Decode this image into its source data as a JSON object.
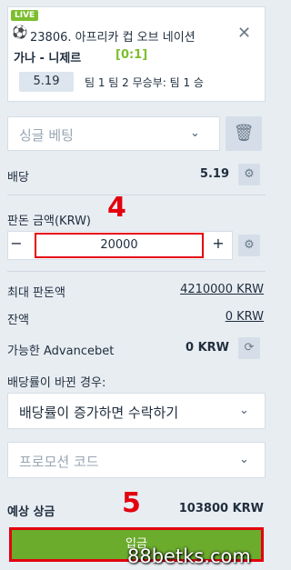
{
  "bet": {
    "live_badge": "LIVE",
    "match_id": "23806. 아프리카 컵 오브 네이션",
    "teams": "가나 - 니제르",
    "score": "[0:1]",
    "odds": "5.19",
    "market": "팀 1 팀 2 무승부: 팀 1 승"
  },
  "bet_type": {
    "selected": "싱글 베팅"
  },
  "odds_row": {
    "label": "배당",
    "value": "5.19"
  },
  "stake": {
    "label": "판돈 금액(KRW)",
    "minus": "−",
    "plus": "+",
    "value": "20000",
    "annotation": "4"
  },
  "max_stake": {
    "label": "최대 판돈액",
    "value": "4210000 KRW"
  },
  "balance": {
    "label": "잔액",
    "value": "0 KRW"
  },
  "advancebet": {
    "label": "가능한 Advancebet",
    "value": "0 KRW"
  },
  "odds_change": {
    "label": "배당률이 바뀐 경우:",
    "selected": "배당률이 증가하면 수락하기"
  },
  "promo": {
    "placeholder": "프로모션 코드"
  },
  "payout": {
    "label": "예상 상금",
    "value": "103800 KRW",
    "annotation": "5"
  },
  "submit_label": "입금",
  "watermark": "88betks.com",
  "colors": {
    "accent_green": "#6cac2d",
    "annotation_red": "#e3000f",
    "background": "#e8edf2"
  }
}
